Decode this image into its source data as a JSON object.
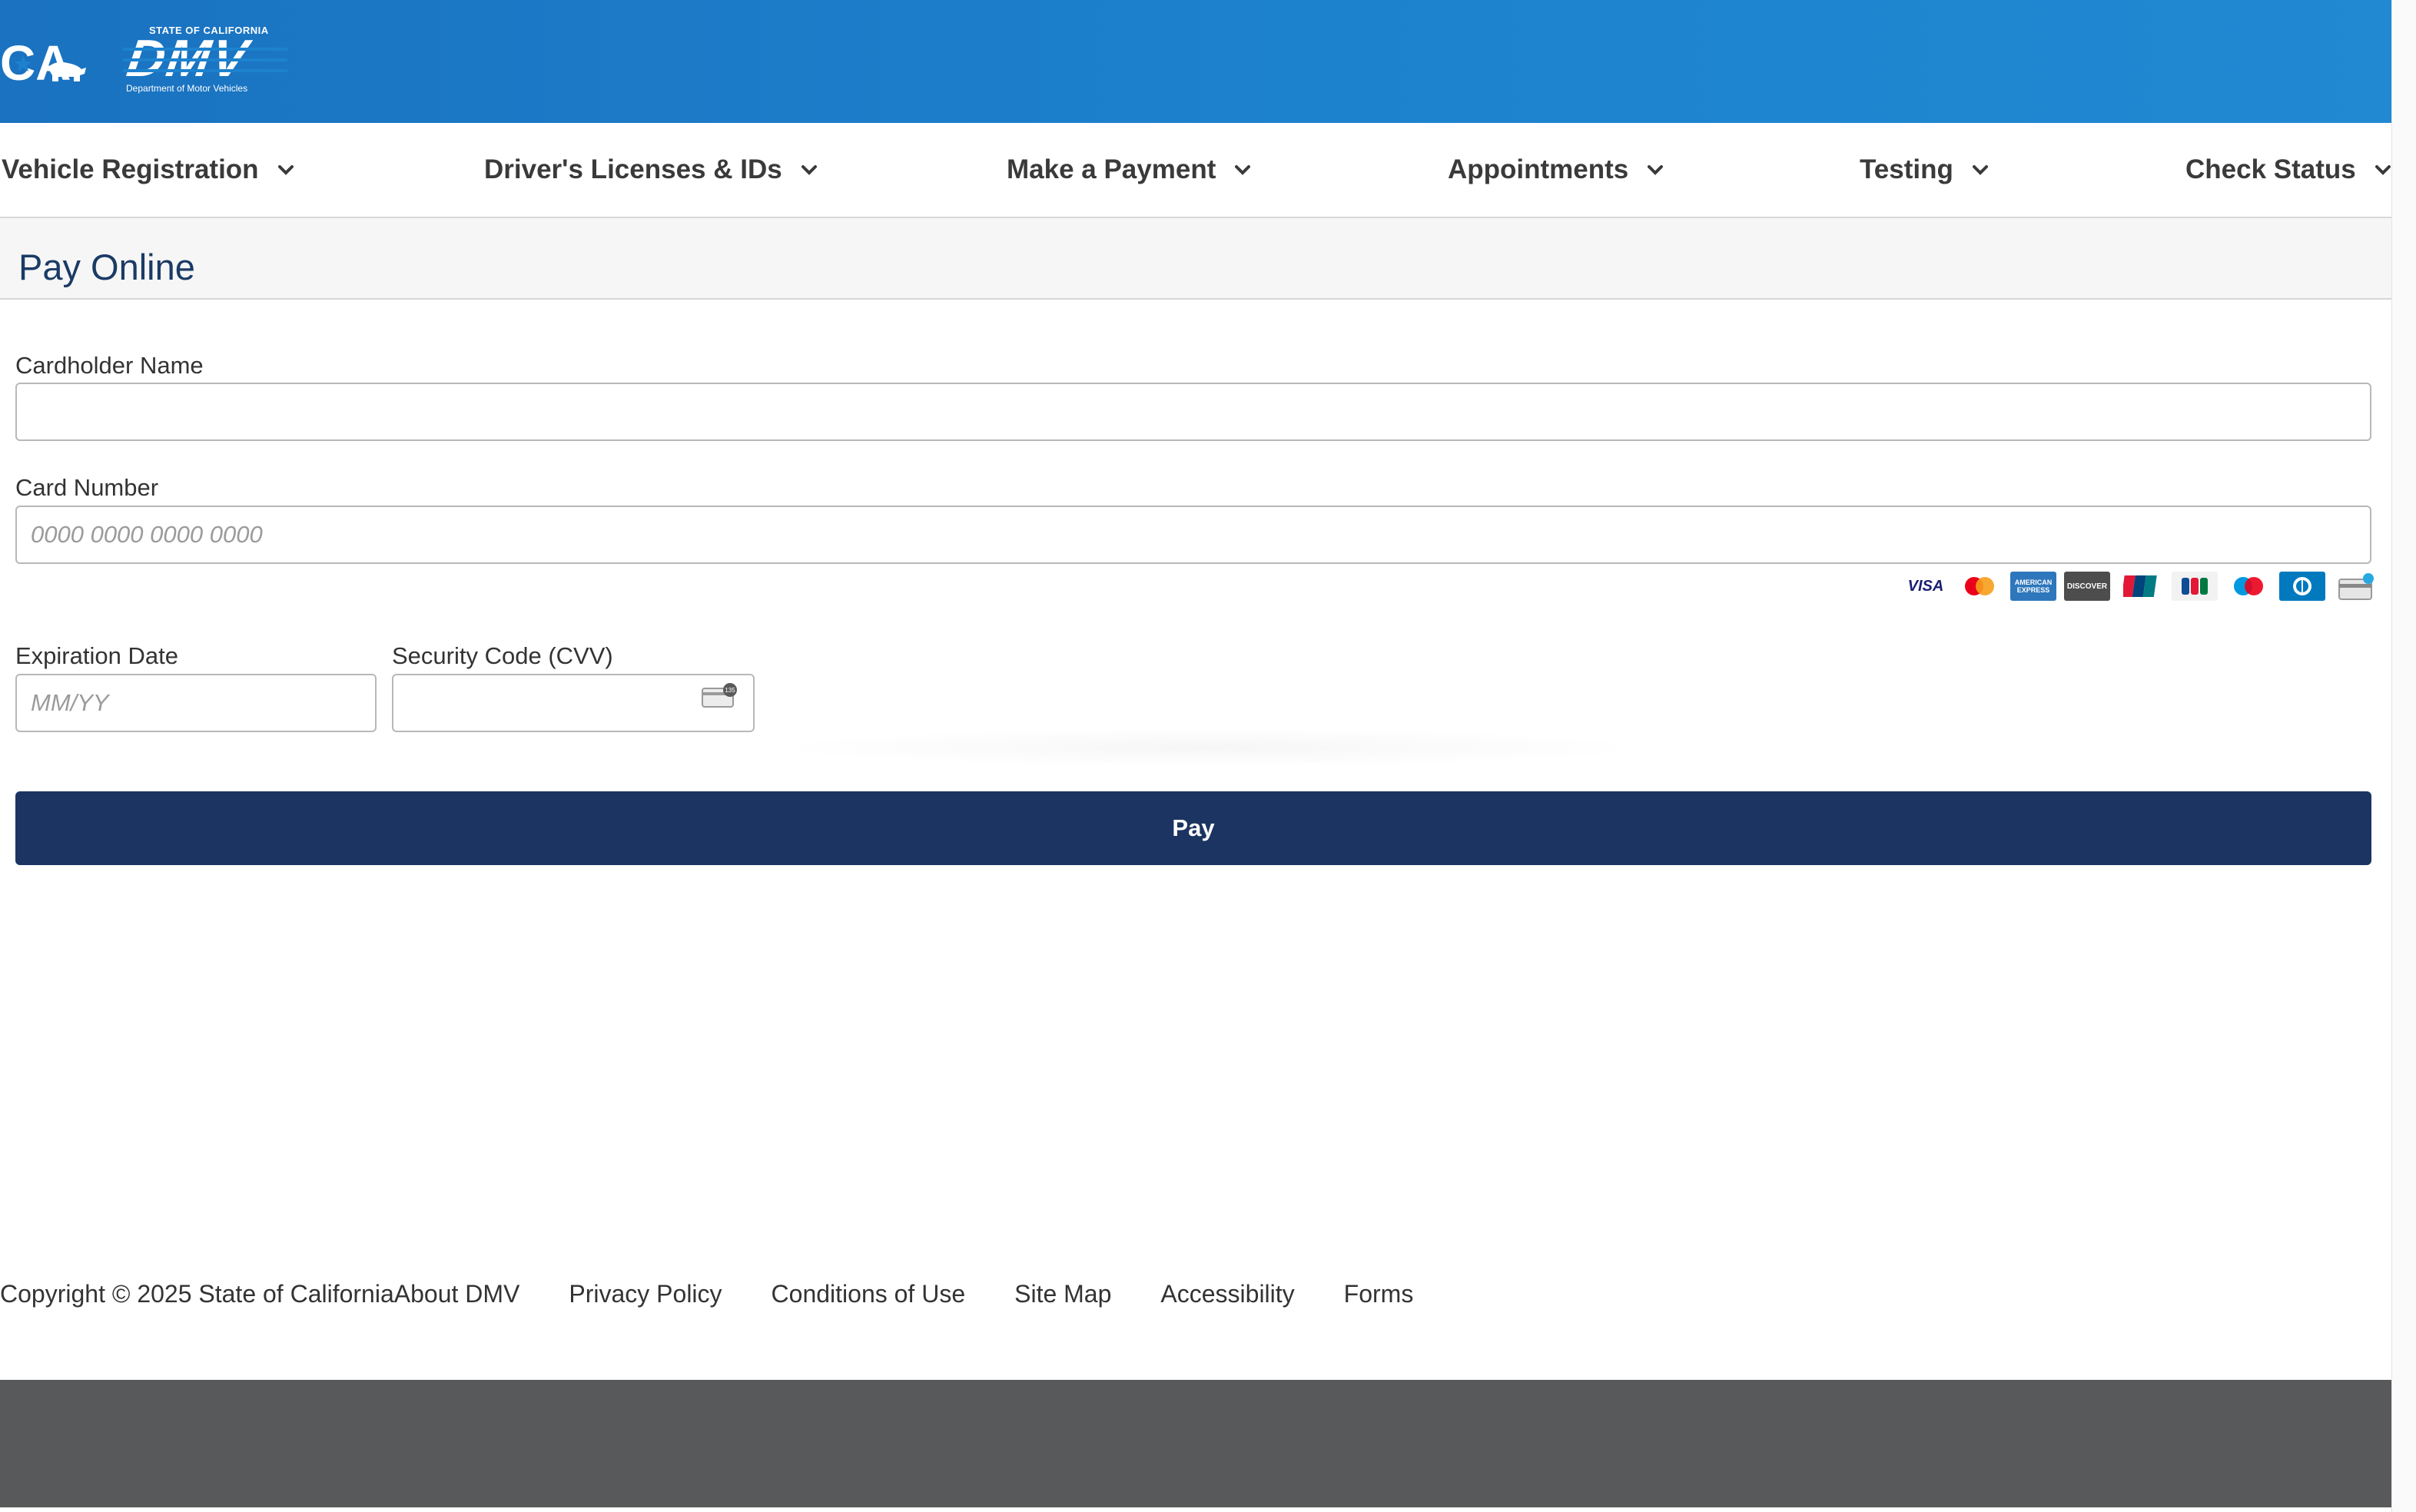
{
  "header": {
    "ca_logo_text": "CA",
    "dmv_state_text": "STATE OF CALIFORNIA",
    "dmv_logo_text": "DMV",
    "dmv_dept_text": "Department of Motor Vehicles",
    "brand_color": "#1d82ce"
  },
  "nav": {
    "items": [
      {
        "label": "Vehicle Registration"
      },
      {
        "label": "Driver's Licenses & IDs"
      },
      {
        "label": "Make a Payment"
      },
      {
        "label": "Appointments"
      },
      {
        "label": "Testing"
      },
      {
        "label": "Check Status"
      }
    ]
  },
  "page": {
    "title": "Pay Online"
  },
  "form": {
    "cardholder_label": "Cardholder Name",
    "cardholder_value": "",
    "card_number_label": "Card Number",
    "card_number_placeholder": "0000 0000 0000 0000",
    "expiration_label": "Expiration Date",
    "expiration_placeholder": "MM/YY",
    "cvv_label": "Security Code (CVV)",
    "cvv_icon_text": "135",
    "pay_button": "Pay",
    "pay_button_color": "#1c3461",
    "accepted_cards": [
      {
        "name": "visa-icon",
        "text": "VISA"
      },
      {
        "name": "mastercard-icon",
        "text": "MasterCard"
      },
      {
        "name": "american-express-icon",
        "text": "AMERICAN EXPRESS"
      },
      {
        "name": "discover-icon",
        "text": "DISCOVER"
      },
      {
        "name": "unionpay-icon",
        "text": "UnionPay"
      },
      {
        "name": "jcb-icon",
        "text": "JCB"
      },
      {
        "name": "maestro-icon",
        "text": "Maestro"
      },
      {
        "name": "diners-club-icon",
        "text": ""
      },
      {
        "name": "generic-card-icon",
        "text": ""
      }
    ]
  },
  "footer": {
    "copyright": "Copyright © 2025 State of California",
    "links": [
      "About DMV",
      "Privacy Policy",
      "Conditions of Use",
      "Site Map",
      "Accessibility",
      "Forms"
    ],
    "bar_color": "#58595b"
  }
}
